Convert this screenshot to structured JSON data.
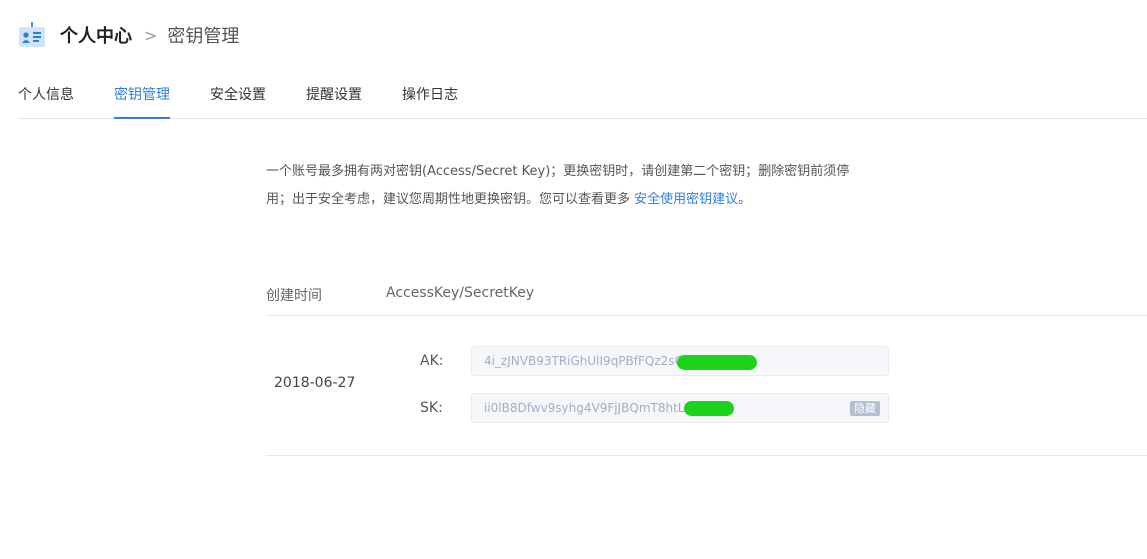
{
  "header": {
    "breadcrumb_root": "个人中心",
    "breadcrumb_separator": ">",
    "breadcrumb_current": "密钥管理"
  },
  "tabs": [
    {
      "label": "个人信息"
    },
    {
      "label": "密钥管理",
      "active": true
    },
    {
      "label": "安全设置"
    },
    {
      "label": "提醒设置"
    },
    {
      "label": "操作日志"
    }
  ],
  "notice": {
    "text_line1": "一个账号最多拥有两对密钥(Access/Secret Key)；更换密钥时，请创建第二个密钥；删除密钥前须停",
    "text_line2": "用；出于安全考虑，建议您周期性地更换密钥。您可以查看更多 ",
    "link": "安全使用密钥建议",
    "tail": "。"
  },
  "table": {
    "headers": [
      "创建时间",
      "AccessKey/SecretKey"
    ],
    "rows": [
      {
        "created": "2018-06-27",
        "ak_label": "AK:",
        "ak_value": "4i_zJNVB93TRiGhUlI9qPBfFQz2sG4",
        "sk_label": "SK:",
        "sk_value": "ii0lB8Dfwv9syhg4V9FjJBQmT8htLL6",
        "hide_label": "隐藏"
      }
    ]
  },
  "colors": {
    "accent": "#2f7fd8",
    "redaction": "#1bd31b"
  }
}
